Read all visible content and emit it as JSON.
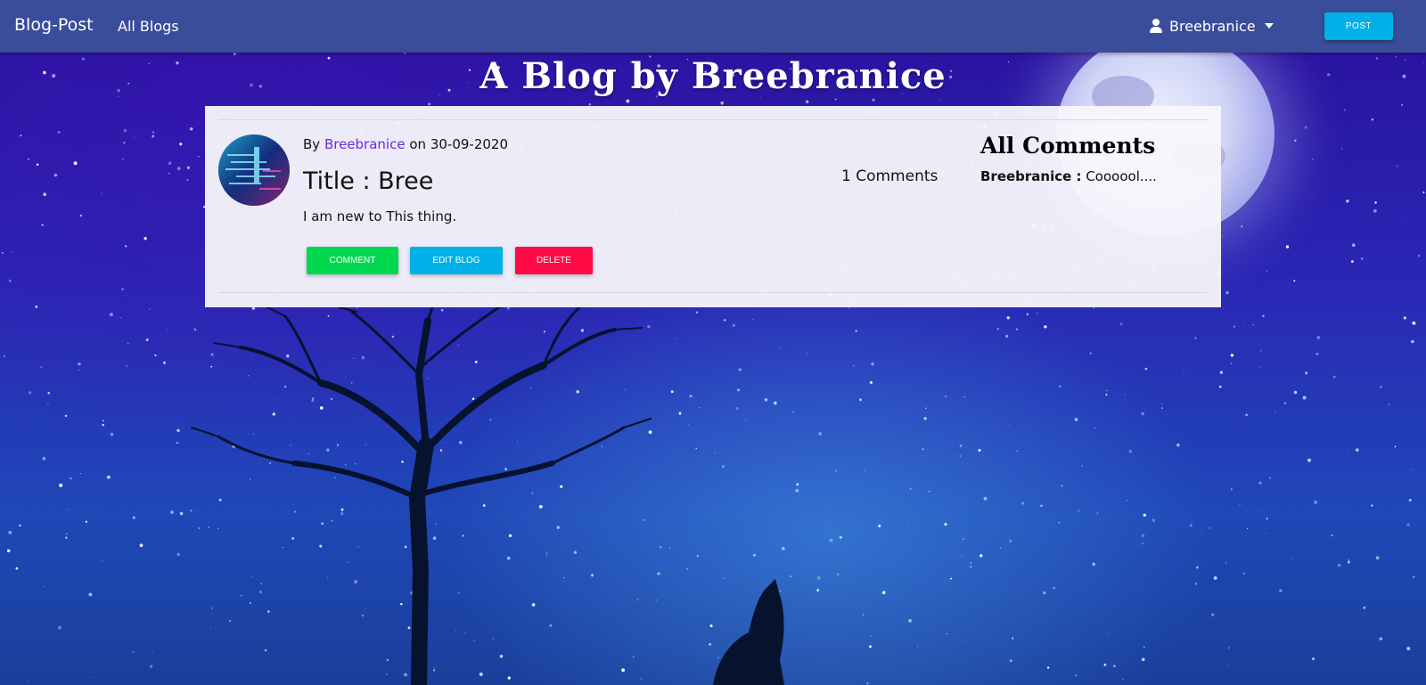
{
  "navbar": {
    "brand": "Blog-Post",
    "all_blogs_link": "All Blogs",
    "user_name": "Breebranice",
    "post_button": "POST"
  },
  "page": {
    "title": "A Blog by Breebranice"
  },
  "post": {
    "by_prefix": "By",
    "author": "Breebranice",
    "on_word": "on",
    "date": "30-09-2020",
    "title": "Title : Bree",
    "body": "I am new to This thing.",
    "comment_count_text": "1 Comments",
    "actions": {
      "comment": "COMMENT",
      "edit": "EDIT BLOG",
      "delete": "DELETE"
    }
  },
  "comments": {
    "heading": "All Comments",
    "items": [
      {
        "author": "Breebranice :",
        "text": "Coooool...."
      }
    ]
  },
  "colors": {
    "navbar": "#3a4d9a",
    "post_button": "#00b0e8",
    "comment_button": "#00d84f",
    "edit_button": "#00b0e8",
    "delete_button": "#ff0a45",
    "author_link": "#6a2bd8"
  }
}
